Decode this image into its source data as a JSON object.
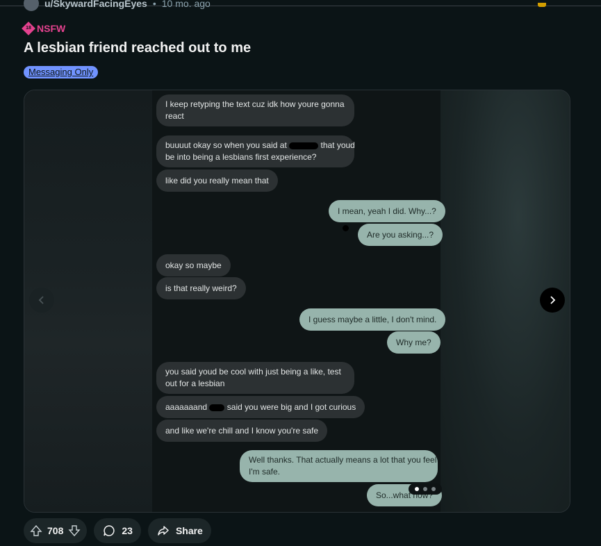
{
  "post": {
    "author": "u/SkywardFacingEyes",
    "separator": "•",
    "time": "10 mo. ago",
    "nsfw_label": "NSFW",
    "nsfw_icon_text": "18",
    "title": "A lesbian friend reached out to me",
    "flair": "Messaging Only"
  },
  "chat": {
    "m1": "I keep retyping the text cuz idk how youre gonna",
    "m1b": "react",
    "m2a": "buuuut okay so when you said at",
    "m2b": "that youd",
    "m2c": "be into being a lesbians first experience?",
    "m3": "like did you really mean that",
    "m4": "I mean, yeah I did. Why...?",
    "m5": "Are you asking...?",
    "m6": "okay so maybe",
    "m7": "is that really weird?",
    "m8": "I guess maybe a little, I don't mind.",
    "m9": "Why me?",
    "m10a": "you said youd be cool with just being a like, test",
    "m10b": "out for a lesbian",
    "m11a": "aaaaaaand",
    "m11b": "said you were big and I got curious",
    "m12": "and like we're chill and I know you're safe",
    "m13a": "Well thanks. That actually means a lot that you feel",
    "m13b": "I'm safe.",
    "m14": "So...what now?"
  },
  "gallery": {
    "current_page": 1,
    "total_pages": 3
  },
  "actions": {
    "upvotes": "708",
    "comments": "23",
    "share": "Share"
  },
  "colors": {
    "background": "#0b1416",
    "nsfw": "#e5428f",
    "flair": "#7193ff",
    "incoming_bubble": "#2c3133",
    "outgoing_bubble": "#97b4ac"
  },
  "icons": [
    "avatar",
    "nsfw-icon",
    "chevron-left-icon",
    "chevron-right-icon",
    "upvote-icon",
    "downvote-icon",
    "comment-icon",
    "share-icon"
  ]
}
